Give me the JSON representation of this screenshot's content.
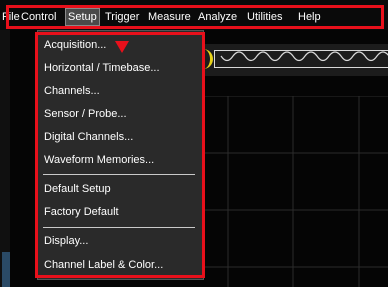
{
  "menubar": {
    "items": [
      "File",
      "Control",
      "Setup",
      "Trigger",
      "Measure",
      "Analyze",
      "Utilities",
      "Help"
    ],
    "active": "Setup"
  },
  "setup_menu": {
    "items": [
      "Acquisition...",
      "Horizontal / Timebase...",
      "Channels...",
      "Sensor / Probe...",
      "Digital Channels...",
      "Waveform Memories...",
      "Default Setup",
      "Factory Default",
      "Display...",
      "Channel Label & Color..."
    ]
  },
  "colors": {
    "highlight": "#e8101b",
    "menu_bg": "#2a2a2a",
    "background": "#050505",
    "channel_marker": "#e6d21a"
  },
  "icons": [
    "down-arrow-icon",
    "waveform-icon"
  ]
}
